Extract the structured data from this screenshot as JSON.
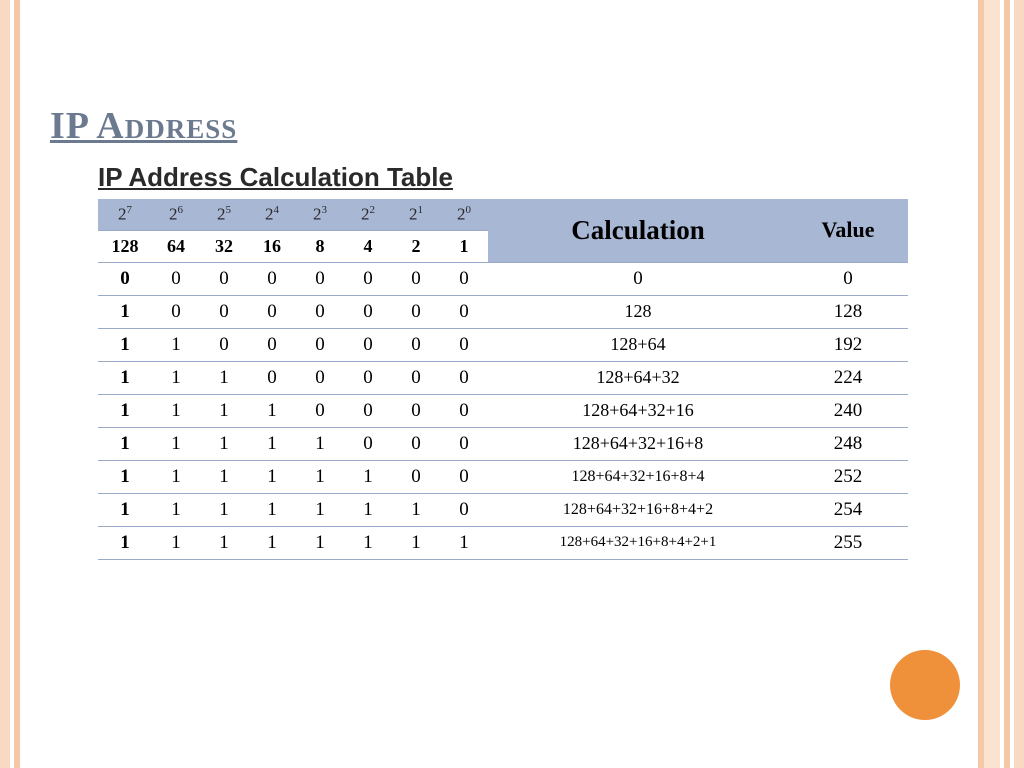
{
  "title": "IP Address",
  "subtitle": "IP Address Calculation Table",
  "chart_data": {
    "type": "table",
    "headers": {
      "powers": [
        "2^7",
        "2^6",
        "2^5",
        "2^4",
        "2^3",
        "2^2",
        "2^1",
        "2^0"
      ],
      "decimals": [
        "128",
        "64",
        "32",
        "16",
        "8",
        "4",
        "2",
        "1"
      ],
      "calc": "Calculation",
      "value": "Value"
    },
    "rows": [
      {
        "bits": [
          "0",
          "0",
          "0",
          "0",
          "0",
          "0",
          "0",
          "0"
        ],
        "calc": "0",
        "value": "0"
      },
      {
        "bits": [
          "1",
          "0",
          "0",
          "0",
          "0",
          "0",
          "0",
          "0"
        ],
        "calc": "128",
        "value": "128"
      },
      {
        "bits": [
          "1",
          "1",
          "0",
          "0",
          "0",
          "0",
          "0",
          "0"
        ],
        "calc": "128+64",
        "value": "192"
      },
      {
        "bits": [
          "1",
          "1",
          "1",
          "0",
          "0",
          "0",
          "0",
          "0"
        ],
        "calc": "128+64+32",
        "value": "224"
      },
      {
        "bits": [
          "1",
          "1",
          "1",
          "1",
          "0",
          "0",
          "0",
          "0"
        ],
        "calc": "128+64+32+16",
        "value": "240"
      },
      {
        "bits": [
          "1",
          "1",
          "1",
          "1",
          "1",
          "0",
          "0",
          "0"
        ],
        "calc": "128+64+32+16+8",
        "value": "248"
      },
      {
        "bits": [
          "1",
          "1",
          "1",
          "1",
          "1",
          "1",
          "0",
          "0"
        ],
        "calc": "128+64+32+16+8+4",
        "value": "252"
      },
      {
        "bits": [
          "1",
          "1",
          "1",
          "1",
          "1",
          "1",
          "1",
          "0"
        ],
        "calc": "128+64+32+16+8+4+2",
        "value": "254"
      },
      {
        "bits": [
          "1",
          "1",
          "1",
          "1",
          "1",
          "1",
          "1",
          "1"
        ],
        "calc": "128+64+32+16+8+4+2+1",
        "value": "255"
      }
    ]
  }
}
